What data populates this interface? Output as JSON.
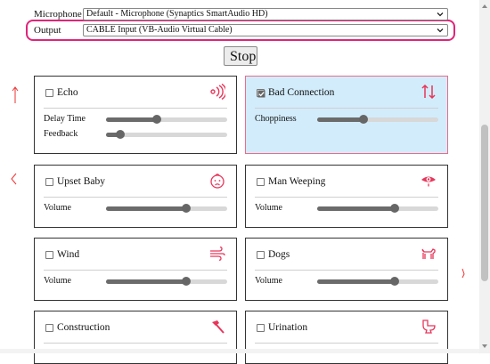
{
  "devices": {
    "microphone_label": "Microphone",
    "microphone_value": "Default - Microphone (Synaptics SmartAudio HD)",
    "output_label": "Output",
    "output_value": "CABLE Input (VB-Audio Virtual Cable)"
  },
  "controls": {
    "stop_label": "Stop"
  },
  "effects": [
    {
      "title": "Echo",
      "checked": false,
      "icon": "echo-icon",
      "params": [
        {
          "label": "Delay Time",
          "value": 0.42
        },
        {
          "label": "Feedback",
          "value": 0.12
        }
      ]
    },
    {
      "title": "Bad Connection",
      "checked": true,
      "icon": "up-down-arrows-icon",
      "params": [
        {
          "label": "Choppiness",
          "value": 0.38
        }
      ]
    },
    {
      "title": "Upset Baby",
      "checked": false,
      "icon": "baby-face-icon",
      "params": [
        {
          "label": "Volume",
          "value": 0.66
        }
      ]
    },
    {
      "title": "Man Weeping",
      "checked": false,
      "icon": "weeping-eye-icon",
      "params": [
        {
          "label": "Volume",
          "value": 0.64
        }
      ]
    },
    {
      "title": "Wind",
      "checked": false,
      "icon": "wind-icon",
      "params": [
        {
          "label": "Volume",
          "value": 0.66
        }
      ]
    },
    {
      "title": "Dogs",
      "checked": false,
      "icon": "dog-icon",
      "params": [
        {
          "label": "Volume",
          "value": 0.64
        }
      ]
    },
    {
      "title": "Construction",
      "checked": false,
      "icon": "hammer-icon",
      "params": []
    },
    {
      "title": "Urination",
      "checked": false,
      "icon": "toilet-icon",
      "params": []
    }
  ],
  "colors": {
    "accent_icon": "#e8365a",
    "active_card_bg": "#d2ecfb",
    "highlight_border": "#e0247a"
  }
}
